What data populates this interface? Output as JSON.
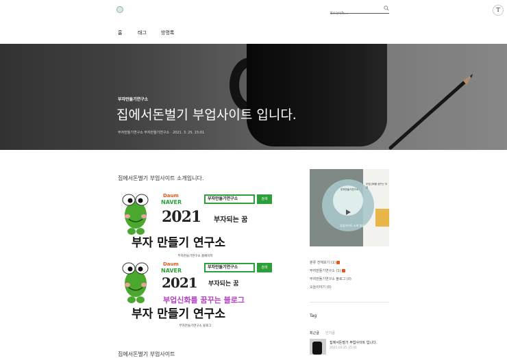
{
  "header": {
    "search_placeholder": "Search...",
    "profile_initial": "T",
    "nav": [
      "홈",
      "태그",
      "방명록"
    ]
  },
  "hero": {
    "category": "부자만들기연구소",
    "title": "집에서돈벌기 부업사이트 입니다.",
    "meta": "부자만들기연구소 부자만들기연구소 · 2021. 3. 25. 15:01"
  },
  "post": {
    "intro": "집에서돈벌기 부업사이트 소개입니다.",
    "banner1": {
      "search_text": "부자만들기연구소",
      "search_button": "검색",
      "year": "2021",
      "slogan": "부자되는 꿈",
      "main_text": "부자 만들기 연구소",
      "caption": "부자만들기연구소 홈페이지"
    },
    "banner2": {
      "search_text": "부자만들기연구소",
      "search_button": "검색",
      "year": "2021",
      "slogan": "부자되는 꿈",
      "tagline": "부업신화를 꿈꾸는 블로그",
      "main_text": "부자 만들기 연구소",
      "caption": "부자만들기연구소 블로그"
    },
    "footer_heading": "집에서돈벌기 부업사이트"
  },
  "sidebar": {
    "image_text_a": "부자만들기연구소",
    "image_text_b": "부업사이트 소개 영상",
    "image_text_c": "부업신화를 꿈꾸는 부업",
    "links": [
      "분류 전체보기 (1)",
      "부자만들기연구소 (1)",
      "부자만들기연구소 블로그 (0)",
      "오늘이야기 (0)"
    ],
    "tag_heading": "Tag",
    "tabs": {
      "recent": "최근글",
      "popular": "인기글"
    },
    "recent_post": {
      "title": "집에서돈벌기 부업사이트 입니다.",
      "date": "2021.03.25 15:01"
    }
  },
  "colors": {
    "frog_green": "#4aa82f",
    "daum_green": "#2d9f3a",
    "banner_red": "#d8332a",
    "tagline_magenta": "#b83fc6",
    "new_badge": "#e25a1c"
  }
}
